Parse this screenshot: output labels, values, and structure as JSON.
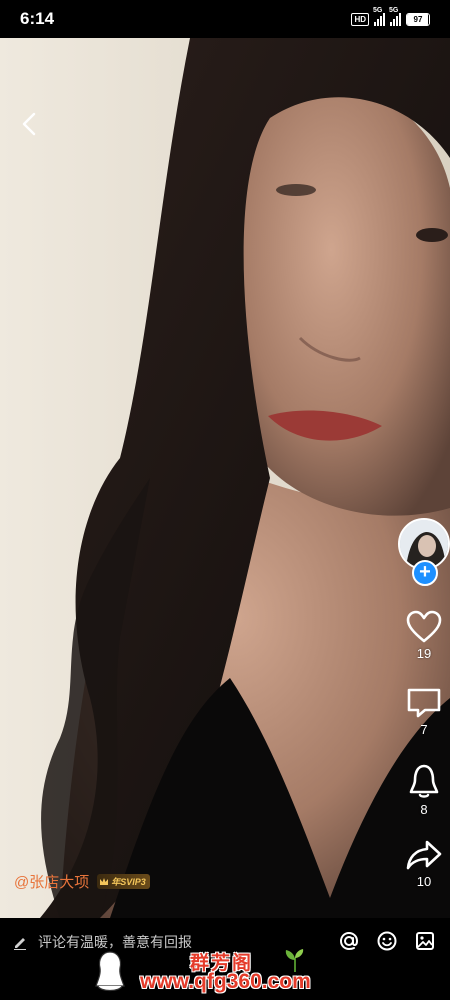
{
  "status_bar": {
    "time": "6:14",
    "hd_label": "HD",
    "signal_1_label": "5G",
    "signal_2_label": "5G",
    "battery_level": "97"
  },
  "video": {
    "description_icons": [
      "back-icon"
    ]
  },
  "sidebar": {
    "follow_label": "+",
    "likes": "19",
    "comments": "7",
    "shares_bell": "8",
    "forwards": "10"
  },
  "author": {
    "name": "@张店大项",
    "vip_label": "年SVIP3"
  },
  "comment_bar": {
    "placeholder": "评论有温暖，善意有回报"
  },
  "watermark": {
    "title": "群芳阁",
    "url": "www.qfg360.com"
  },
  "colors": {
    "author_name": "#e8743b",
    "follow_button": "#1e90ff",
    "watermark": "#e43b2a"
  }
}
